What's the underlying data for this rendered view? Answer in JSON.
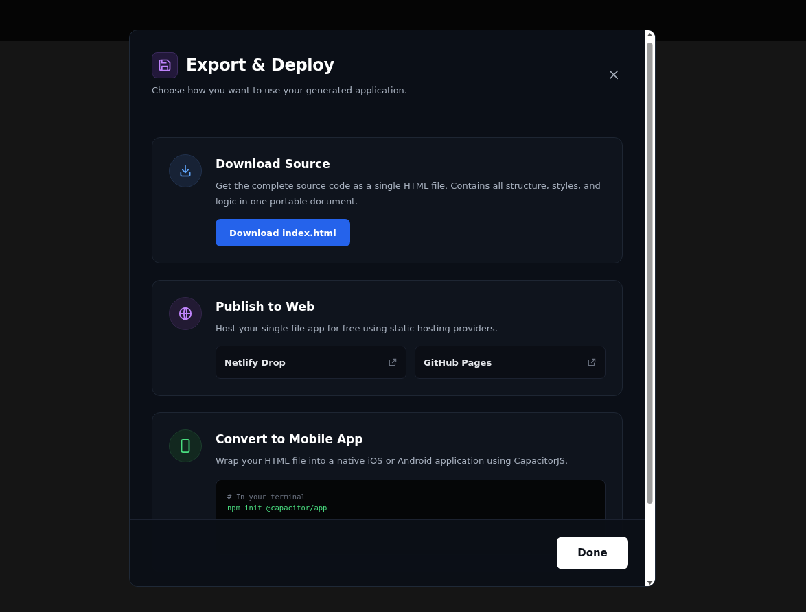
{
  "dialog": {
    "title": "Export & Deploy",
    "subtitle": "Choose how you want to use your generated application.",
    "options": [
      {
        "kind": "download",
        "title": "Download Source",
        "description": "Get the complete source code as a single HTML file. Contains all structure, styles, and logic in one portable document.",
        "button": "Download index.html"
      },
      {
        "kind": "publish",
        "title": "Publish to Web",
        "description": "Host your single-file app for free using static hosting providers.",
        "links": [
          "Netlify Drop",
          "GitHub Pages"
        ]
      },
      {
        "kind": "mobile",
        "title": "Convert to Mobile App",
        "description": "Wrap your HTML file into a native iOS or Android application using CapacitorJS.",
        "code": [
          {
            "kind": "comment",
            "text": "# In your terminal"
          },
          {
            "kind": "command",
            "text": "npm init @capacitor/app"
          }
        ]
      }
    ],
    "done_button": "Done"
  }
}
